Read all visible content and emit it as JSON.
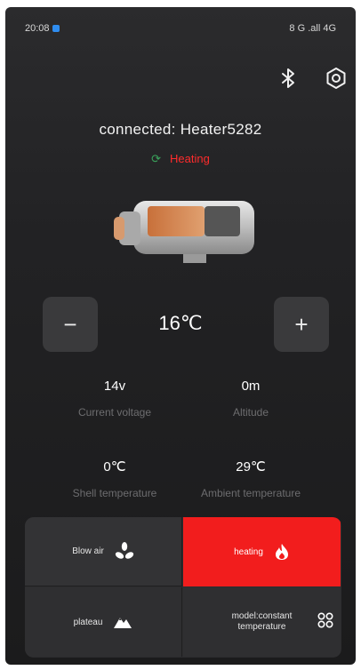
{
  "status_bar": {
    "time": "20:08",
    "right": "8 G .all 4G"
  },
  "header": {
    "connected_label": "connected:",
    "device_name": "Heater5282"
  },
  "state": {
    "label": "Heating"
  },
  "temperature": {
    "value": "16℃",
    "minus": "−",
    "plus": "+"
  },
  "metrics": [
    {
      "value": "14v",
      "label": "Current voltage"
    },
    {
      "value": "0m",
      "label": "Altitude"
    },
    {
      "value": "0℃",
      "label": "Shell temperature"
    },
    {
      "value": "29℃",
      "label": "Ambient temperature"
    }
  ],
  "modes": [
    {
      "label": "Blow air",
      "icon": "fan-icon"
    },
    {
      "label": "heating",
      "icon": "flame-icon",
      "active": true
    },
    {
      "label": "plateau",
      "icon": "mountain-icon"
    },
    {
      "label": "model:constant temperature",
      "icon": "grid-icon"
    }
  ],
  "colors": {
    "accent": "#f21d1d",
    "state_text": "#ff2b2b",
    "background": "#222224"
  }
}
